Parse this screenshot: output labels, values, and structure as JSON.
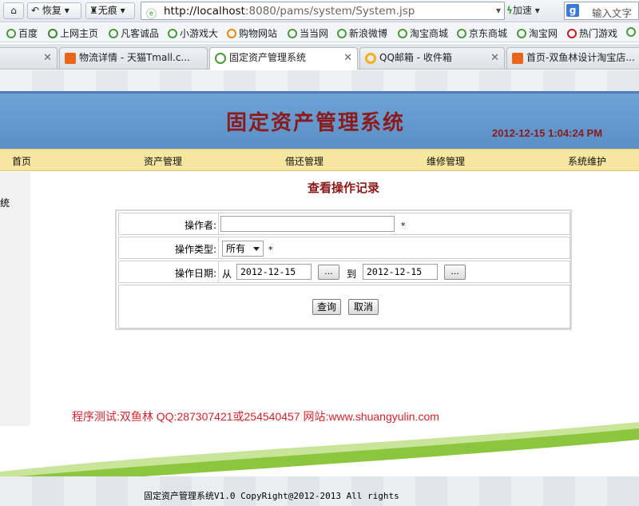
{
  "browser": {
    "back_label": "恢复",
    "no_trace_label": "无痕",
    "url_host": "http://localhost",
    "url_rest": ":8080/pams/system/System.jsp",
    "speed_label": "加速",
    "search_placeholder": "输入文字"
  },
  "bookmarks": [
    "百度",
    "上网主页",
    "凡客诚品",
    "小游戏大",
    "购物网站",
    "当当网",
    "新浪微博",
    "淘宝商城",
    "京东商城",
    "淘宝网",
    "热门游戏"
  ],
  "tabs": [
    {
      "label": "物流详情 - 天猫Tmall.c..."
    },
    {
      "label": "固定资产管理系统"
    },
    {
      "label": "QQ邮箱 - 收件箱"
    },
    {
      "label": "首页-双鱼林设计淘宝店..."
    }
  ],
  "header": {
    "title": "固定资产管理系统",
    "clock": "2012-12-15 1:04:24 PM"
  },
  "nav": [
    "首页",
    "资产管理",
    "借还管理",
    "维修管理",
    "系统维护"
  ],
  "sidebar_label": "统",
  "section_title": "查看操作记录",
  "form": {
    "operator_label": "操作者:",
    "operator_value": "",
    "type_label": "操作类型:",
    "type_value": "所有",
    "date_label": "操作日期:",
    "from_label": "从",
    "to_label": "到",
    "date_from": "2012-12-15",
    "date_to": "2012-12-15",
    "dots": "...",
    "required_mark": "*",
    "query_label": "查询",
    "cancel_label": "取消"
  },
  "credit": "程序测试:双鱼林 QQ:287307421或254540457 网站:www.shuangyulin.com",
  "footer": "固定资产管理系统V1.0 CopyRight@2012-2013 All rights"
}
